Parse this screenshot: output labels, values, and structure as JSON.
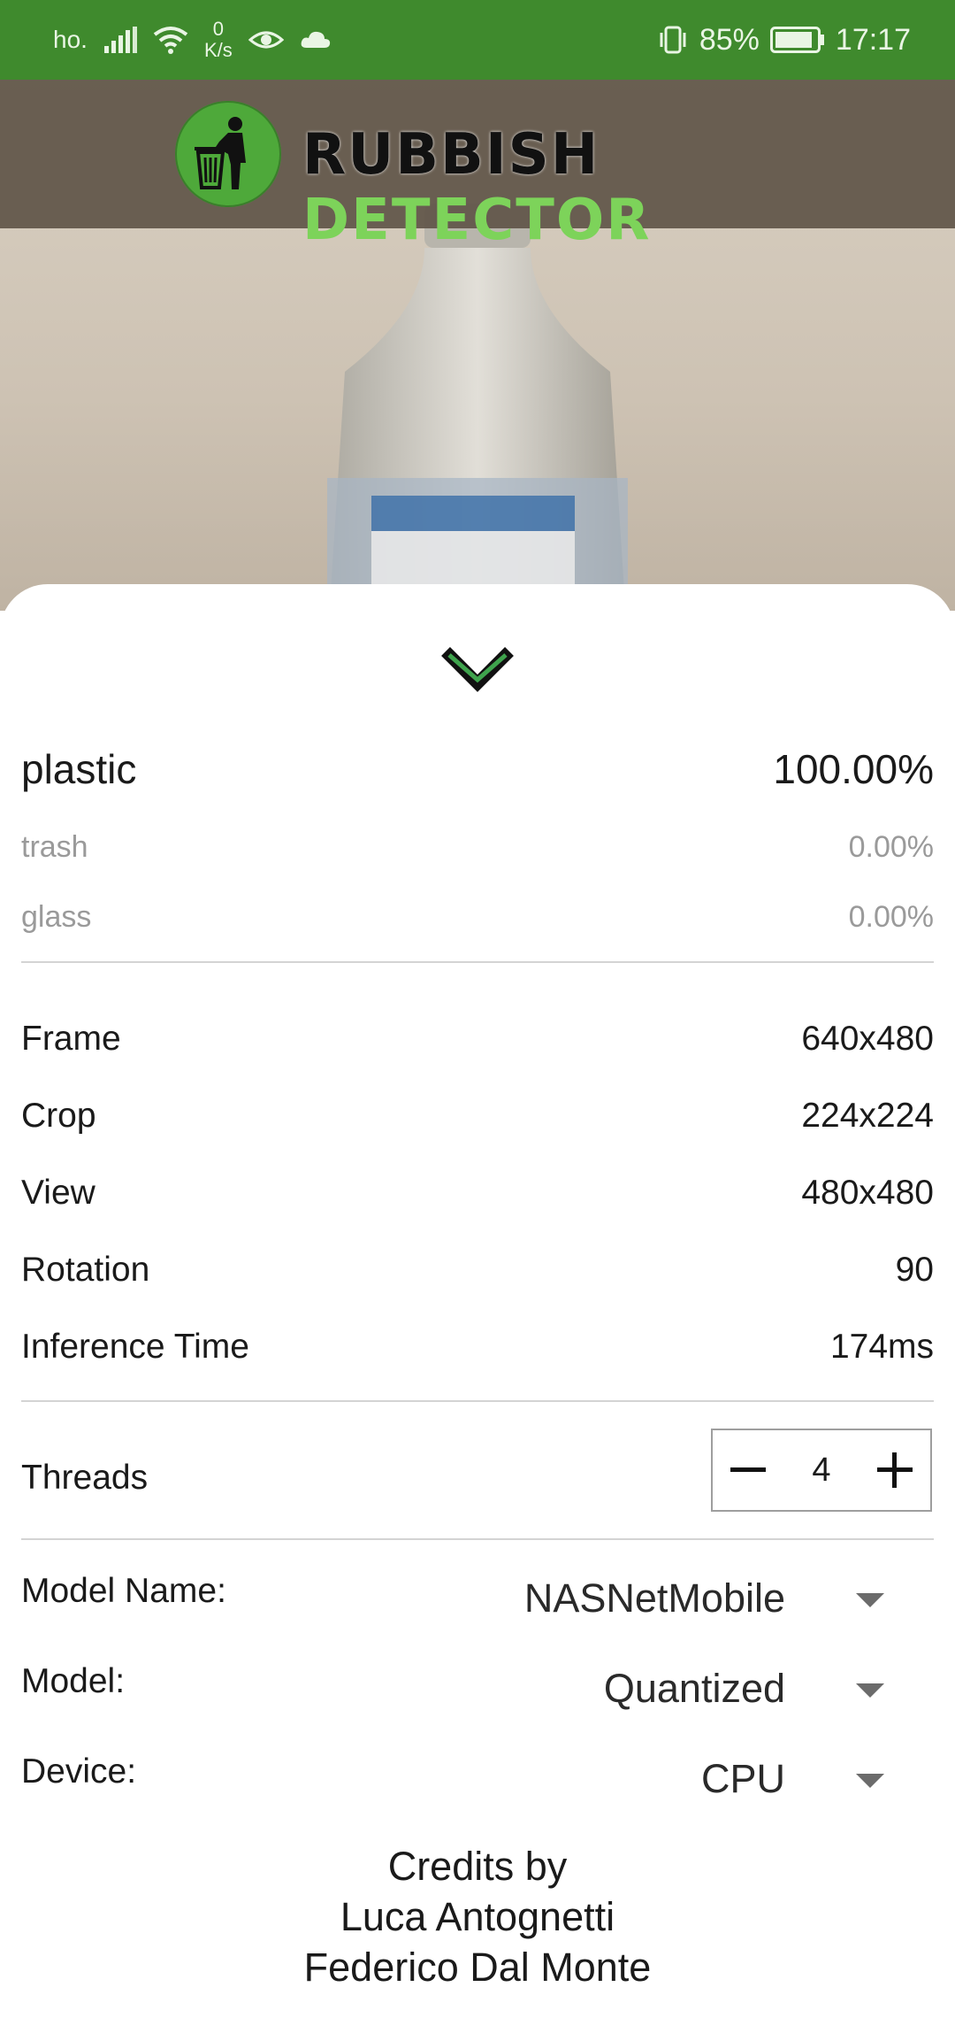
{
  "status_bar": {
    "carrier": "ho.",
    "net_speed_value": "0",
    "net_speed_unit": "K/s",
    "battery": "85%",
    "time": "17:17",
    "icons": [
      "signal-icon",
      "wifi-icon",
      "eye-icon",
      "cloud-icon",
      "vibrate-icon",
      "battery-icon"
    ]
  },
  "app": {
    "title_word1": "RUBBISH",
    "title_word2": "DETECTOR",
    "accent": "#4ea93a",
    "statusbar_color": "#3f8a2d"
  },
  "results": [
    {
      "label": "plastic",
      "value": "100.00%"
    },
    {
      "label": "trash",
      "value": "0.00%"
    },
    {
      "label": "glass",
      "value": "0.00%"
    }
  ],
  "info": [
    {
      "label": "Frame",
      "value": "640x480"
    },
    {
      "label": "Crop",
      "value": "224x224"
    },
    {
      "label": "View",
      "value": "480x480"
    },
    {
      "label": "Rotation",
      "value": "90"
    },
    {
      "label": "Inference Time",
      "value": "174ms"
    }
  ],
  "threads": {
    "label": "Threads",
    "value": "4"
  },
  "selectors": [
    {
      "label": "Model Name:",
      "value": "NASNetMobile"
    },
    {
      "label": "Model:",
      "value": "Quantized"
    },
    {
      "label": "Device:",
      "value": "CPU"
    }
  ],
  "credits": {
    "line1": "Credits by",
    "line2": "Luca Antognetti",
    "line3": "Federico Dal Monte"
  }
}
